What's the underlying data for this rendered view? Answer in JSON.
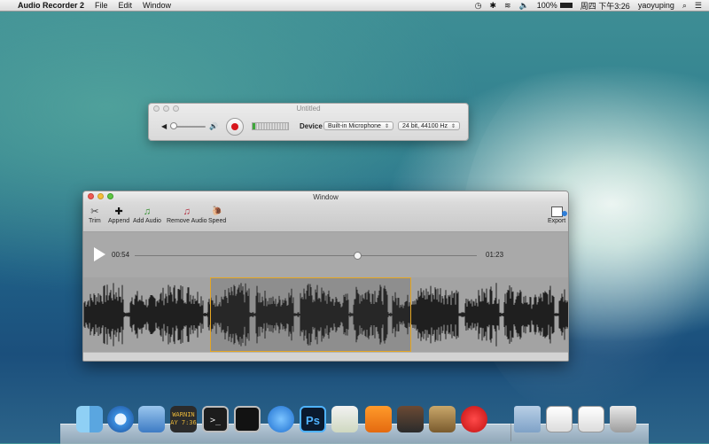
{
  "menubar": {
    "apple_glyph": "",
    "app_name": "Audio Recorder 2",
    "menus": [
      "File",
      "Edit",
      "Window"
    ],
    "status": {
      "battery": "100%",
      "clock": "周四 下午3:26",
      "user": "yaoyuping"
    }
  },
  "recorder_window": {
    "title": "Untitled",
    "device_label": "Device",
    "device_value": "Built-in Microphone",
    "format_value": "24 bit, 44100 Hz",
    "volume_level": 0.05,
    "input_level": 0.08
  },
  "main_window": {
    "title": "Window",
    "toolbar": [
      {
        "id": "trim",
        "label": "Trim",
        "icon": "trim-icon",
        "glyph": "✂"
      },
      {
        "id": "append",
        "label": "Append",
        "icon": "plus-icon",
        "glyph": "✚"
      },
      {
        "id": "add-audio",
        "label": "Add Audio",
        "icon": "music-note-green-icon",
        "glyph": "♫"
      },
      {
        "id": "remove-audio",
        "label": "Remove Audio",
        "icon": "music-note-red-icon",
        "glyph": "♫"
      },
      {
        "id": "speed",
        "label": "Speed",
        "icon": "snail-icon",
        "glyph": "🐌"
      }
    ],
    "export_label": "Export",
    "player": {
      "current_time": "00:54",
      "total_time": "01:23",
      "progress": 0.65
    },
    "selection": {
      "start": 0.26,
      "end": 0.67
    }
  },
  "colors": {
    "record_red": "#d7161c",
    "selection_border": "#e5a623",
    "add_green": "#2f8d2b",
    "remove_red": "#b1283a"
  },
  "dock": {
    "icons": [
      {
        "name": "finder-icon"
      },
      {
        "name": "safari-icon"
      },
      {
        "name": "xcode-icon"
      },
      {
        "name": "console-icon",
        "text": "WARNIN AY 7:36"
      },
      {
        "name": "terminal-icon",
        "text": ">_"
      },
      {
        "name": "activity-monitor-icon"
      },
      {
        "name": "app-store-icon"
      },
      {
        "name": "photoshop-icon",
        "text": "Ps"
      },
      {
        "name": "preview-icon"
      },
      {
        "name": "ibooks-icon"
      },
      {
        "name": "photo-booth-icon"
      },
      {
        "name": "mail-icon"
      },
      {
        "name": "audio-recorder-icon"
      },
      {
        "name": "downloads-folder-icon"
      },
      {
        "name": "document-stack-icon"
      },
      {
        "name": "document-stack-2-icon"
      },
      {
        "name": "trash-icon"
      }
    ]
  }
}
